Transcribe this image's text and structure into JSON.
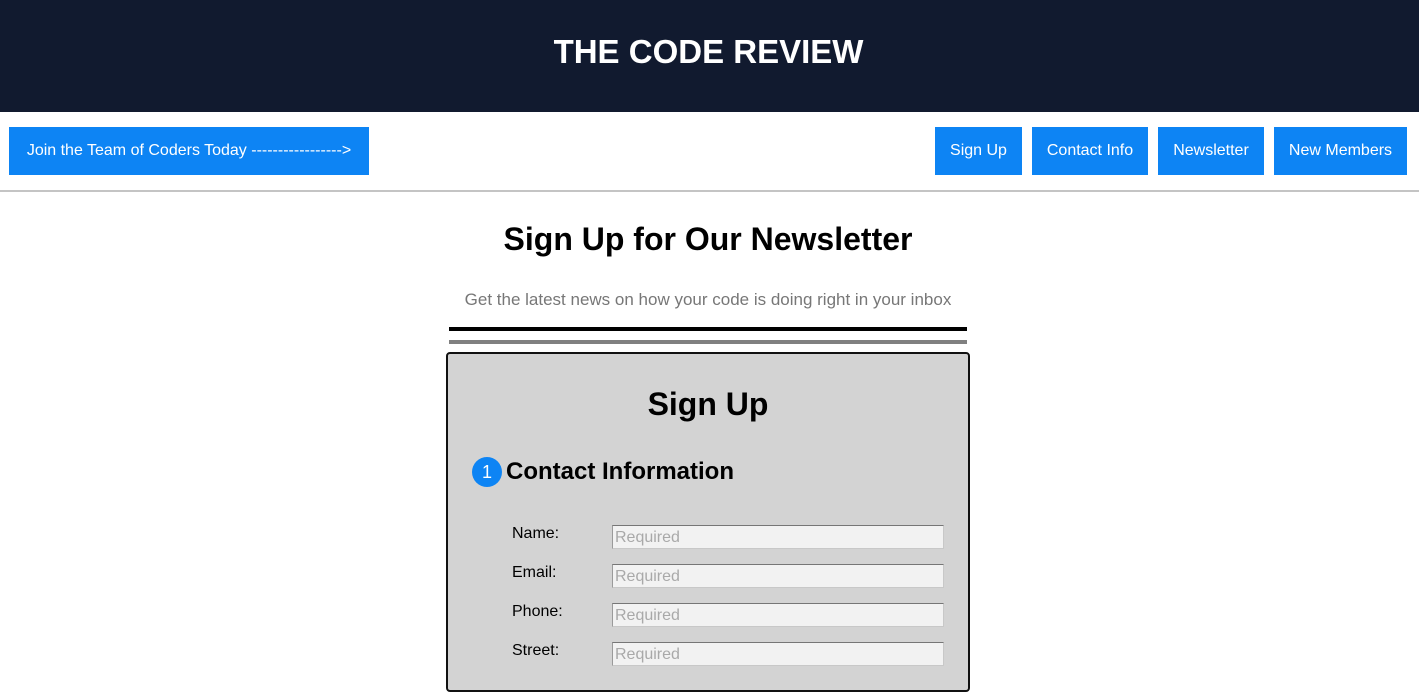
{
  "header": {
    "title": "THE CODE REVIEW"
  },
  "nav": {
    "join_label": "Join the Team of Coders Today ----------------->",
    "items": [
      {
        "label": "Sign Up"
      },
      {
        "label": "Contact Info"
      },
      {
        "label": "Newsletter"
      },
      {
        "label": "New Members"
      }
    ]
  },
  "main": {
    "heading": "Sign Up for Our Newsletter",
    "subheading": "Get the latest news on how your code is doing right in your inbox"
  },
  "form": {
    "title": "Sign Up",
    "section": {
      "number": "1",
      "title": "Contact Information"
    },
    "fields": [
      {
        "label": "Name:",
        "value": "",
        "placeholder": "Required"
      },
      {
        "label": "Email:",
        "value": "",
        "placeholder": "Required"
      },
      {
        "label": "Phone:",
        "value": "",
        "placeholder": "Required"
      },
      {
        "label": "Street:",
        "value": "",
        "placeholder": "Required"
      }
    ]
  },
  "colors": {
    "header_bg": "#111a2f",
    "accent": "#0d84f4",
    "panel_bg": "#d3d3d3"
  }
}
